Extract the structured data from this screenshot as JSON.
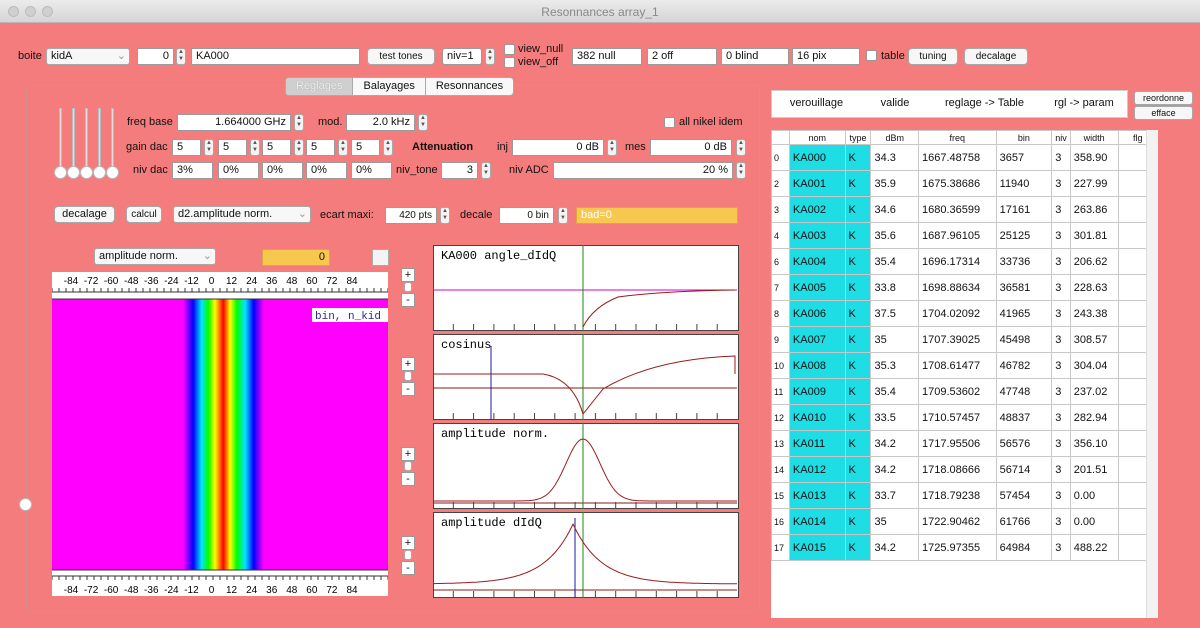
{
  "window": {
    "title": "Resonnances array_1"
  },
  "toolbar": {
    "boite_label": "boite",
    "boite_value": "kidA",
    "num_value": "0",
    "kid_name": "KA000",
    "test_tones": "test tones",
    "niv": "niv=1",
    "view_null": "view_null",
    "view_off": "view_off",
    "null_count": "382 null",
    "off_count": "2 off",
    "blind_count": "0 blind",
    "pix_count": "16 pix",
    "table_label": "table",
    "tuning": "tuning",
    "decalage": "decalage"
  },
  "tabs": [
    "Reglages",
    "Balayages",
    "Resonnances"
  ],
  "controls": {
    "freq_base_label": "freq base",
    "freq_base_value": "1.664000 GHz",
    "mod_label": "mod.",
    "mod_value": "2.0 kHz",
    "all_nikel": "all nikel idem",
    "gain_dac_label": "gain dac",
    "gain_dac_values": [
      "5",
      "5",
      "5",
      "5",
      "5"
    ],
    "attenuation_label": "Attenuation",
    "inj_label": "inj",
    "inj_value": "0 dB",
    "mes_label": "mes",
    "mes_value": "0 dB",
    "niv_dac_label": "niv dac",
    "niv_dac_values": [
      "3%",
      "0%",
      "0%",
      "0%",
      "0%"
    ],
    "niv_tone_label": "niv_tone",
    "niv_tone_value": "3",
    "niv_adc_label": "niv ADC",
    "niv_adc_value": "20 %"
  },
  "row2": {
    "decalage": "decalage",
    "calcul": "calcul",
    "mode": "d2.amplitude norm.",
    "ecart_label": "ecart maxi:",
    "ecart_value": "420 pts",
    "decale_label": "decale",
    "decale_value": "0 bin",
    "bad": "bad=0"
  },
  "heatmap": {
    "select": "amplitude norm.",
    "value": "0",
    "legend": "bin, n_kid",
    "ticks": [
      "-84",
      "-72",
      "-60",
      "-48",
      "-36",
      "-24",
      "-12",
      "0",
      "12",
      "24",
      "36",
      "48",
      "60",
      "72",
      "84"
    ]
  },
  "plots": [
    {
      "title": "KA000   angle_dIdQ"
    },
    {
      "title": "cosinus"
    },
    {
      "title": "amplitude norm."
    },
    {
      "title": "amplitude dIdQ"
    }
  ],
  "pm": {
    "plus": "+",
    "minus": "-"
  },
  "right": {
    "verrouillage": "verouillage",
    "valide": "valide",
    "reglage_table": "reglage -> Table",
    "rgl_param": "rgl -> param",
    "reordonne": "reordonne",
    "efface": "efface"
  },
  "table": {
    "headers": [
      "",
      "nom",
      "type",
      "dBm",
      "freq",
      "bin",
      "niv",
      "width",
      "flg"
    ],
    "rows": [
      [
        "0",
        "KA000",
        "K",
        "34.3",
        "1667.48758",
        "3657",
        "3",
        "358.90",
        ""
      ],
      [
        "2",
        "KA001",
        "K",
        "35.9",
        "1675.38686",
        "11940",
        "3",
        "227.99",
        ""
      ],
      [
        "3",
        "KA002",
        "K",
        "34.6",
        "1680.36599",
        "17161",
        "3",
        "263.86",
        ""
      ],
      [
        "4",
        "KA003",
        "K",
        "35.6",
        "1687.96105",
        "25125",
        "3",
        "301.81",
        ""
      ],
      [
        "6",
        "KA004",
        "K",
        "35.4",
        "1696.17314",
        "33736",
        "3",
        "206.62",
        ""
      ],
      [
        "7",
        "KA005",
        "K",
        "33.8",
        "1698.88634",
        "36581",
        "3",
        "228.63",
        ""
      ],
      [
        "8",
        "KA006",
        "K",
        "37.5",
        "1704.02092",
        "41965",
        "3",
        "243.38",
        ""
      ],
      [
        "9",
        "KA007",
        "K",
        "35",
        "1707.39025",
        "45498",
        "3",
        "308.57",
        ""
      ],
      [
        "10",
        "KA008",
        "K",
        "35.3",
        "1708.61477",
        "46782",
        "3",
        "304.04",
        ""
      ],
      [
        "11",
        "KA009",
        "K",
        "35.4",
        "1709.53602",
        "47748",
        "3",
        "237.02",
        ""
      ],
      [
        "12",
        "KA010",
        "K",
        "33.5",
        "1710.57457",
        "48837",
        "3",
        "282.94",
        ""
      ],
      [
        "13",
        "KA011",
        "K",
        "34.2",
        "1717.95506",
        "56576",
        "3",
        "356.10",
        ""
      ],
      [
        "14",
        "KA012",
        "K",
        "34.2",
        "1718.08666",
        "56714",
        "3",
        "201.51",
        ""
      ],
      [
        "15",
        "KA013",
        "K",
        "33.7",
        "1718.79238",
        "57454",
        "3",
        "0.00",
        ""
      ],
      [
        "16",
        "KA014",
        "K",
        "35",
        "1722.90462",
        "61766",
        "3",
        "0.00",
        ""
      ],
      [
        "17",
        "KA015",
        "K",
        "34.2",
        "1725.97355",
        "64984",
        "3",
        "488.22",
        ""
      ]
    ]
  }
}
